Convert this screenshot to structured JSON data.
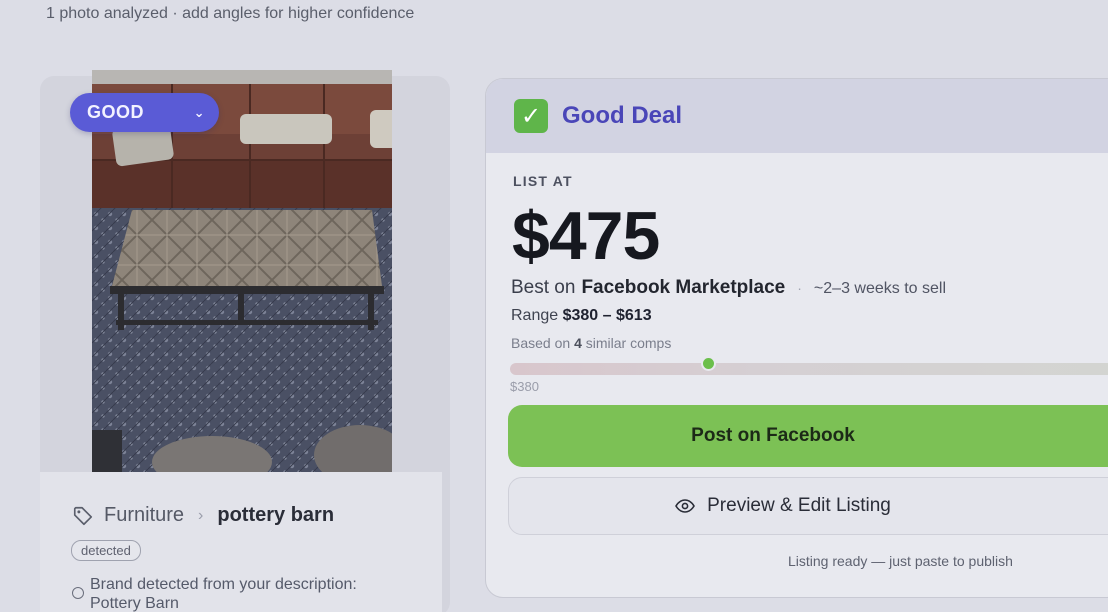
{
  "summary": {
    "photo_count_text": "1 photo analyzed · add angles for higher confidence"
  },
  "item": {
    "condition": "GOOD",
    "category": "Furniture",
    "brand": "pottery barn",
    "detected_chip": "detected",
    "brand_note": "Brand detected from your description: Pottery Barn",
    "icons": {
      "tag": "tag-icon",
      "condition_dropdown": "chevron-down-icon",
      "category_separator": "chevron-right-icon",
      "brand_note": "info-circle-icon"
    }
  },
  "deal": {
    "verdict_emoji": "✓",
    "verdict": "Good Deal",
    "list_at_label": "LIST AT",
    "price": "$475",
    "best_on_prefix": "Best on",
    "platform": "Facebook Marketplace",
    "dot": "·",
    "time_to_sell": "~2–3 weeks to sell",
    "range_label": "Range",
    "range_value": "$380 – $613",
    "comps_prefix": "Based on",
    "comps_count": "4",
    "comps_suffix": "similar comps",
    "range_min_label": "$380",
    "price_position_pct": 32,
    "post_button": "Post on Facebook",
    "preview_button": "Preview & Edit Listing",
    "ready_note": "Listing ready — just paste to publish",
    "colors": {
      "accent": "#4a46b8",
      "success": "#7cc155",
      "pill": "#5a5bd6"
    }
  }
}
